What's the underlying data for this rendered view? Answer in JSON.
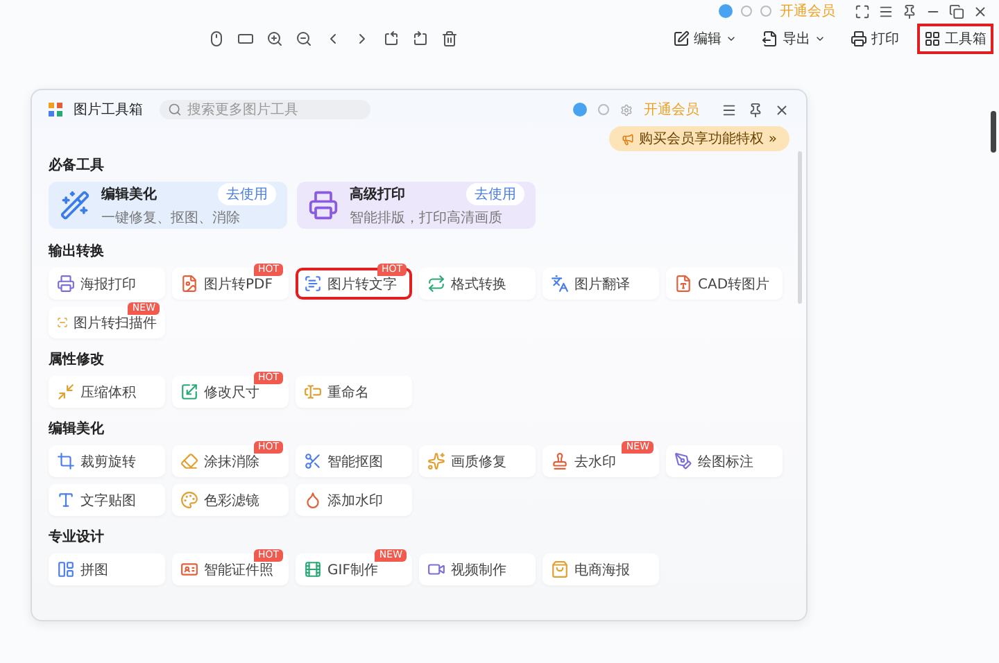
{
  "top_bar": {
    "vip_link": "开通会员"
  },
  "actions": [
    {
      "label": "编辑",
      "dropdown": true,
      "highlighted": false
    },
    {
      "label": "导出",
      "dropdown": true,
      "highlighted": false
    },
    {
      "label": "打印",
      "dropdown": false,
      "highlighted": false
    },
    {
      "label": "工具箱",
      "dropdown": false,
      "highlighted": true
    }
  ],
  "panel": {
    "title": "图片工具箱",
    "search": {
      "placeholder": "搜索更多图片工具"
    },
    "vip_link": "开通会员",
    "promo": "购买会员享功能特权 »",
    "sections": [
      {
        "title": "必备工具",
        "kind": "featured",
        "items": [
          {
            "title": "编辑美化",
            "subtitle": "一键修复、抠图、消除",
            "button": "去使用"
          },
          {
            "title": "高级打印",
            "subtitle": "智能排版，打印高清画质",
            "button": "去使用"
          }
        ]
      },
      {
        "title": "输出转换",
        "kind": "grid",
        "items": [
          {
            "label": "海报打印",
            "highlighted": false
          },
          {
            "label": "图片转PDF",
            "badge": "HOT",
            "highlighted": false
          },
          {
            "label": "图片转文字",
            "badge": "HOT",
            "highlighted": true
          },
          {
            "label": "格式转换",
            "highlighted": false
          },
          {
            "label": "图片翻译",
            "highlighted": false
          },
          {
            "label": "CAD转图片",
            "highlighted": false
          },
          {
            "label": "图片转扫描件",
            "badge": "NEW",
            "highlighted": false
          }
        ]
      },
      {
        "title": "属性修改",
        "kind": "grid",
        "items": [
          {
            "label": "压缩体积",
            "highlighted": false
          },
          {
            "label": "修改尺寸",
            "badge": "HOT",
            "highlighted": false
          },
          {
            "label": "重命名",
            "highlighted": false
          }
        ]
      },
      {
        "title": "编辑美化",
        "kind": "grid",
        "items": [
          {
            "label": "裁剪旋转",
            "highlighted": false
          },
          {
            "label": "涂抹消除",
            "badge": "HOT",
            "highlighted": false
          },
          {
            "label": "智能抠图",
            "highlighted": false
          },
          {
            "label": "画质修复",
            "highlighted": false
          },
          {
            "label": "去水印",
            "badge": "NEW",
            "highlighted": false
          },
          {
            "label": "绘图标注",
            "highlighted": false
          },
          {
            "label": "文字贴图",
            "highlighted": false
          },
          {
            "label": "色彩滤镜",
            "highlighted": false
          },
          {
            "label": "添加水印",
            "highlighted": false
          }
        ]
      },
      {
        "title": "专业设计",
        "kind": "grid",
        "items": [
          {
            "label": "拼图",
            "highlighted": false
          },
          {
            "label": "智能证件照",
            "badge": "HOT",
            "highlighted": false
          },
          {
            "label": "GIF制作",
            "badge": "NEW",
            "highlighted": false
          },
          {
            "label": "视频制作",
            "highlighted": false
          },
          {
            "label": "电商海报",
            "highlighted": false
          }
        ]
      }
    ]
  }
}
